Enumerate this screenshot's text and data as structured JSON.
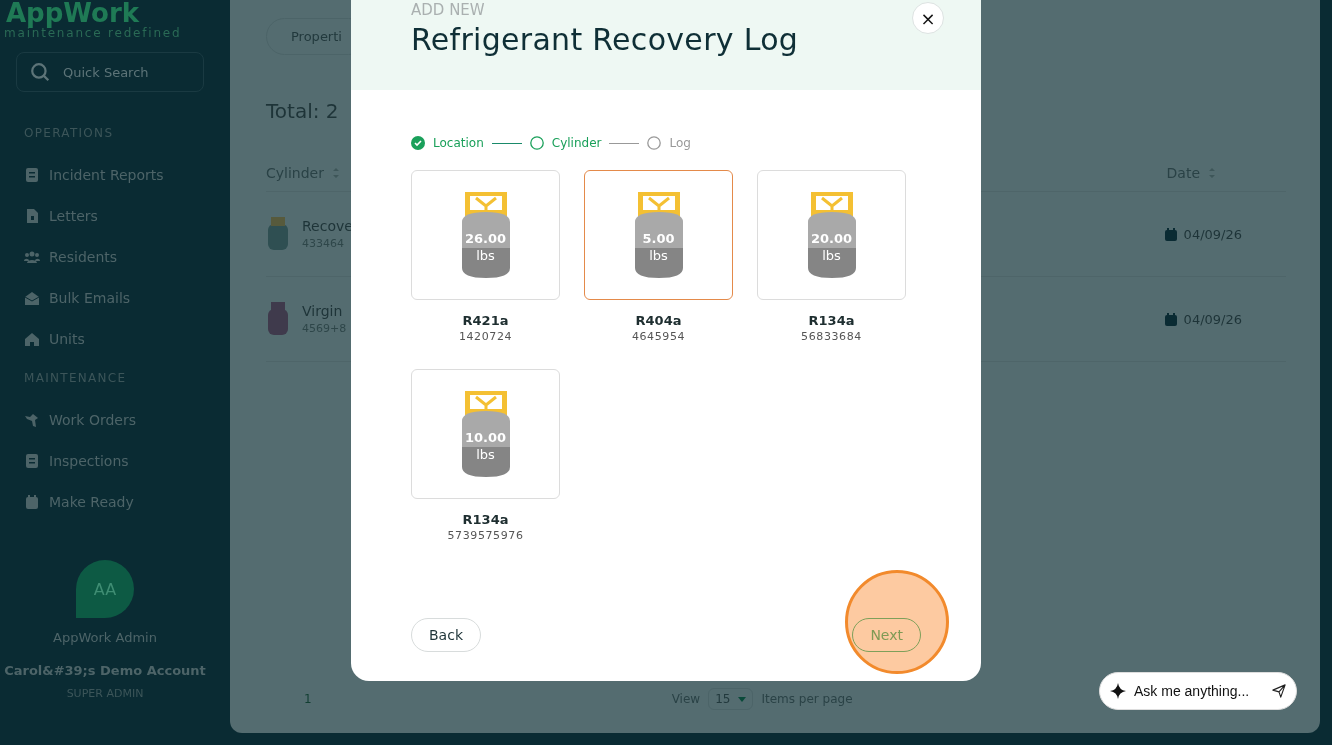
{
  "sidebar": {
    "logo": "AppWork",
    "tagline": "maintenance redefined",
    "search": {
      "placeholder": "Quick Search"
    },
    "sections": [
      {
        "heading": "OPERATIONS",
        "items": [
          {
            "label": "Incident Reports",
            "kind": "report"
          },
          {
            "label": "Letters",
            "kind": "file"
          },
          {
            "label": "Residents",
            "kind": "people"
          },
          {
            "label": "Bulk Emails",
            "kind": "mail"
          },
          {
            "label": "Units",
            "kind": "home"
          }
        ]
      },
      {
        "heading": "MAINTENANCE",
        "items": [
          {
            "label": "Work Orders",
            "kind": "tool"
          },
          {
            "label": "Inspections",
            "kind": "report"
          },
          {
            "label": "Make Ready",
            "kind": "calendar"
          }
        ]
      }
    ],
    "user": {
      "initials": "AA",
      "name": "AppWork Admin",
      "account": "Carol&#39;s Demo Account",
      "role": "SUPER ADMIN"
    }
  },
  "main": {
    "tab": "Properti",
    "total": "Total: 2",
    "columns": [
      {
        "label": "Cylinder"
      },
      {
        "label": "Date"
      }
    ],
    "rows": [
      {
        "name": "Recove",
        "serial": "433464",
        "date": "04/09/26",
        "color": "#2f4f52"
      },
      {
        "name": "Virgin",
        "serial": "4569+8",
        "date": "04/09/26",
        "color": "#3f3a4c"
      }
    ],
    "pagination": {
      "page": "1",
      "view": "View",
      "per_page": "15",
      "items_label": "Items per page"
    }
  },
  "modal": {
    "eyebrow": "ADD NEW",
    "title": "Refrigerant Recovery Log",
    "close": "×",
    "steps": [
      {
        "label": "Location",
        "kind": "done"
      },
      {
        "label": "Cylinder",
        "kind": "current"
      },
      {
        "label": "Log",
        "kind": "pending"
      }
    ],
    "cylinders": [
      {
        "weight": "26.00",
        "unit": "lbs",
        "name": "R421a",
        "serial": "1420724",
        "selected": false
      },
      {
        "weight": "5.00",
        "unit": "lbs",
        "name": "R404a",
        "serial": "4645954",
        "selected": true
      },
      {
        "weight": "20.00",
        "unit": "lbs",
        "name": "R134a",
        "serial": "56833684",
        "selected": false
      },
      {
        "weight": "10.00",
        "unit": "lbs",
        "name": "R134a",
        "serial": "5739575976",
        "selected": false
      }
    ],
    "back": "Back",
    "next": "Next"
  },
  "chat": {
    "placeholder": "Ask me anything..."
  }
}
